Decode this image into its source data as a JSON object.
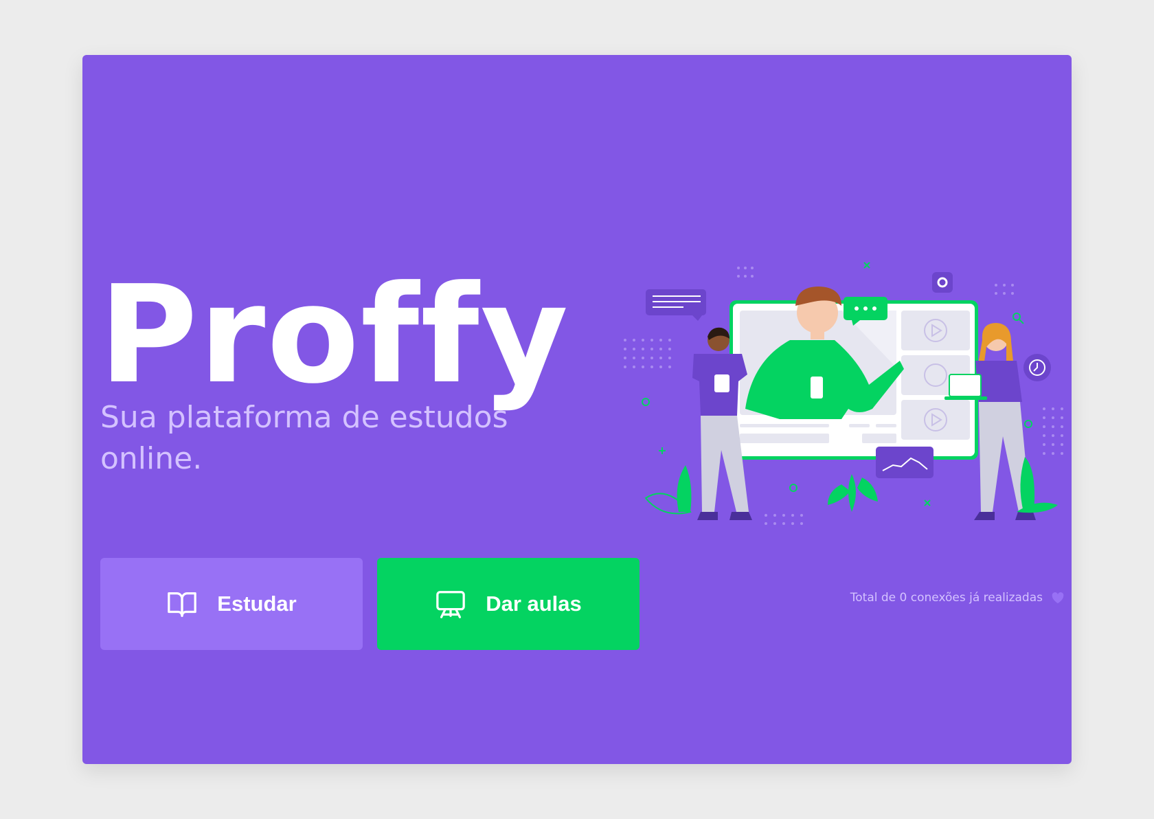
{
  "brand": {
    "logo_text": "Proffy",
    "tagline": "Sua plataforma de estudos online."
  },
  "actions": {
    "study_label": "Estudar",
    "teach_label": "Dar aulas"
  },
  "footer": {
    "total_connections": "Total de 0 conexões já realizadas"
  },
  "colors": {
    "background": "#8257e5",
    "study_button": "#9871f5",
    "teach_button": "#04d361",
    "tagline": "#d4c2ff"
  },
  "icons": {
    "study": "book-open-icon",
    "teach": "presentation-board-icon",
    "footer": "purple-heart-icon",
    "hero": "online-class-illustration"
  }
}
